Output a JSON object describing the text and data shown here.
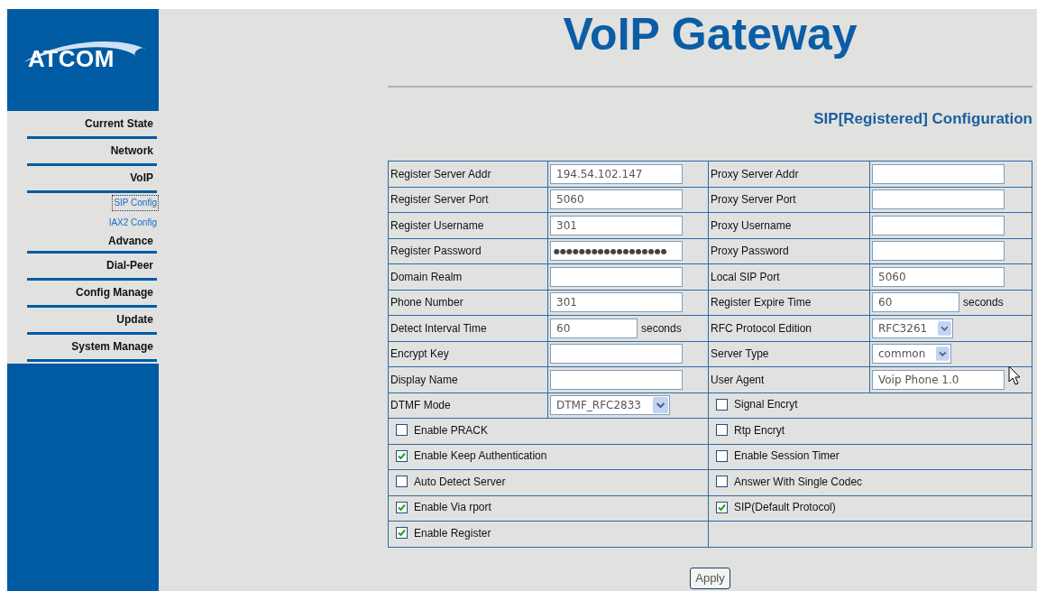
{
  "logo": {
    "text": "ATCOM"
  },
  "sidebar": {
    "items": [
      {
        "label": "Current State"
      },
      {
        "label": "Network"
      },
      {
        "label": "VoIP",
        "children": [
          {
            "label": "SIP Config",
            "selected": true
          },
          {
            "label": "IAX2 Config",
            "selected": false
          }
        ]
      },
      {
        "label": "Advance"
      },
      {
        "label": "Dial-Peer"
      },
      {
        "label": "Config Manage"
      },
      {
        "label": "Update"
      },
      {
        "label": "System Manage"
      }
    ]
  },
  "header": {
    "title": "VoIP Gateway",
    "subtitle": "SIP[Registered] Configuration"
  },
  "form": {
    "rows": [
      {
        "cells": [
          {
            "kind": "field",
            "label": "Register Server Addr",
            "value": "194.54.102.147"
          },
          {
            "kind": "field",
            "label": "Proxy Server Addr"
          }
        ]
      },
      {
        "cells": [
          {
            "kind": "field",
            "label": "Register Server Port",
            "value": "5060"
          },
          {
            "kind": "field",
            "label": "Proxy Server Port"
          }
        ]
      },
      {
        "cells": [
          {
            "kind": "field",
            "label": "Register Username",
            "value": "301"
          },
          {
            "kind": "field",
            "label": "Proxy Username"
          }
        ]
      },
      {
        "cells": [
          {
            "kind": "password",
            "label": "Register Password",
            "value": "●●●●●●●●●●●●●●●●●●"
          },
          {
            "kind": "field",
            "label": "Proxy Password"
          }
        ]
      },
      {
        "cells": [
          {
            "kind": "field",
            "label": "Domain Realm"
          },
          {
            "kind": "field",
            "label": "Local SIP Port",
            "value": "5060"
          }
        ]
      },
      {
        "cells": [
          {
            "kind": "field",
            "label": "Phone Number",
            "value": "301"
          },
          {
            "kind": "field",
            "label": "Register Expire Time",
            "value": "60",
            "unit": "seconds"
          }
        ]
      },
      {
        "cells": [
          {
            "kind": "field",
            "label": "Detect Interval Time",
            "value": "60",
            "unit": "seconds"
          },
          {
            "kind": "select",
            "label": "RFC Protocol Edition",
            "value": "RFC3261"
          }
        ]
      },
      {
        "cells": [
          {
            "kind": "field",
            "label": "Encrypt Key"
          },
          {
            "kind": "select",
            "label": "Server Type",
            "value": "common"
          }
        ]
      },
      {
        "cells": [
          {
            "kind": "field",
            "label": "Display Name"
          },
          {
            "kind": "field",
            "label": "User Agent",
            "value": "Voip Phone 1.0"
          }
        ]
      },
      {
        "cells": [
          {
            "kind": "select",
            "label": "DTMF Mode",
            "value": "DTMF_RFC2833"
          },
          {
            "kind": "check",
            "label": "Signal Encryt",
            "checked": false
          }
        ]
      },
      {
        "cells": [
          {
            "kind": "check",
            "label": "Enable PRACK",
            "checked": false
          },
          {
            "kind": "check",
            "label": "Rtp Encryt",
            "checked": false
          }
        ]
      },
      {
        "cells": [
          {
            "kind": "check",
            "label": "Enable Keep Authentication",
            "checked": true
          },
          {
            "kind": "check",
            "label": "Enable Session Timer",
            "checked": false
          }
        ]
      },
      {
        "cells": [
          {
            "kind": "check",
            "label": "Auto Detect Server",
            "checked": false
          },
          {
            "kind": "check",
            "label": "Answer With Single Codec",
            "checked": false
          }
        ]
      },
      {
        "cells": [
          {
            "kind": "check",
            "label": "Enable Via rport",
            "checked": true
          },
          {
            "kind": "check",
            "label": "SIP(Default Protocol)",
            "checked": true
          }
        ]
      },
      {
        "cells": [
          {
            "kind": "check",
            "label": "Enable Register",
            "checked": true
          },
          {
            "kind": "empty"
          }
        ]
      }
    ]
  },
  "apply_button": {
    "label": "Apply"
  }
}
